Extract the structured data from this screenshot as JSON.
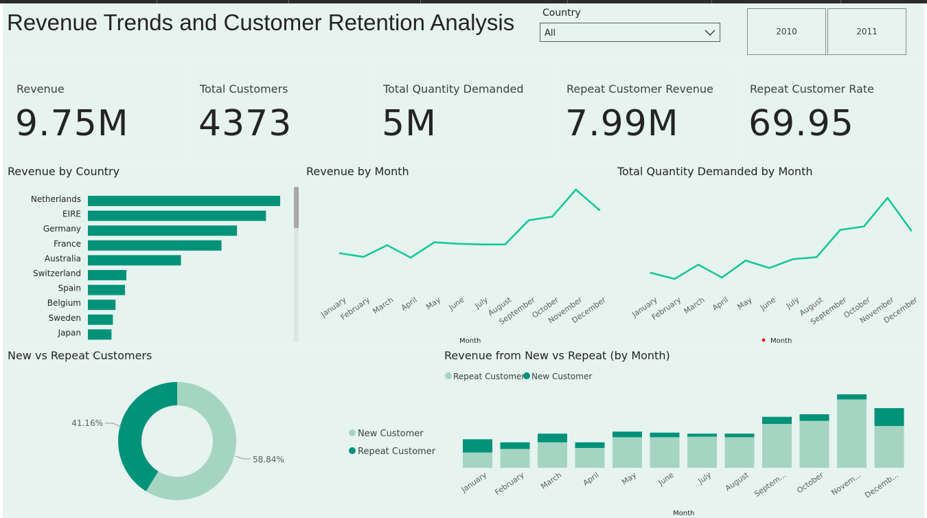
{
  "header": {
    "title": "Revenue Trends and Customer Retention Analysis",
    "country_filter": {
      "label": "Country",
      "value": "All"
    },
    "year_buttons": [
      "2010",
      "2011"
    ]
  },
  "cards": [
    {
      "label": "Revenue",
      "value": "9.75M"
    },
    {
      "label": "Total Customers",
      "value": "4373"
    },
    {
      "label": "Total Quantity Demanded",
      "value": "5M"
    },
    {
      "label": "Repeat Customer Revenue",
      "value": "7.99M"
    },
    {
      "label": "Repeat Customer Rate",
      "value": "69.95"
    }
  ],
  "colors": {
    "primary": "#01937a",
    "light": "#a5d5c2",
    "line": "#16c79a",
    "panel": "#e6f3ef",
    "legend_dot": "#e0201b"
  },
  "charts": {
    "revenue_by_country": {
      "title": "Revenue by Country"
    },
    "revenue_by_month": {
      "title": "Revenue by Month",
      "xlabel": "Month"
    },
    "quantity_by_month": {
      "title": "Total Quantity Demanded by Month",
      "xlabel": "Month"
    },
    "new_vs_repeat": {
      "title": "New vs Repeat Customers",
      "legend": [
        "New Customer",
        "Repeat Customer"
      ],
      "label_small": "41.16%",
      "label_large": "58.84%"
    },
    "revenue_new_vs_repeat": {
      "title": "Revenue from New vs Repeat (by Month)",
      "legend": [
        "Repeat Customer",
        "New Customer"
      ],
      "xlabel": "Month",
      "tick_labels": [
        "January",
        "February",
        "March",
        "April",
        "May",
        "June",
        "July",
        "August",
        "Septem...",
        "October",
        "Novem...",
        "Decemb..."
      ]
    }
  },
  "chart_data": [
    {
      "type": "bar",
      "orientation": "horizontal",
      "title": "Revenue by Country",
      "categories": [
        "Netherlands",
        "EIRE",
        "Germany",
        "France",
        "Australia",
        "Switzerland",
        "Spain",
        "Belgium",
        "Sweden",
        "Japan"
      ],
      "values": [
        285000,
        264000,
        221000,
        198000,
        138000,
        57000,
        55000,
        41000,
        37000,
        35000
      ]
    },
    {
      "type": "line",
      "title": "Revenue by Month",
      "xlabel": "Month",
      "categories": [
        "January",
        "February",
        "March",
        "April",
        "May",
        "June",
        "July",
        "August",
        "September",
        "October",
        "November",
        "December"
      ],
      "values": [
        570000,
        520000,
        680000,
        510000,
        720000,
        700000,
        690000,
        690000,
        1020000,
        1070000,
        1440000,
        1160000
      ]
    },
    {
      "type": "line",
      "title": "Total Quantity Demanded by Month",
      "xlabel": "Month",
      "categories": [
        "January",
        "February",
        "March",
        "April",
        "May",
        "June",
        "July",
        "August",
        "September",
        "October",
        "November",
        "December"
      ],
      "values": [
        310000,
        265000,
        370000,
        275000,
        400000,
        345000,
        410000,
        425000,
        625000,
        650000,
        860000,
        620000
      ]
    },
    {
      "type": "pie",
      "title": "New vs Repeat Customers",
      "categories": [
        "Repeat Customer",
        "New Customer"
      ],
      "values": [
        58.84,
        41.16
      ]
    },
    {
      "type": "bar",
      "stacked": true,
      "title": "Revenue from New vs Repeat (by Month)",
      "xlabel": "Month",
      "categories": [
        "January",
        "February",
        "March",
        "April",
        "May",
        "June",
        "July",
        "August",
        "September",
        "October",
        "November",
        "December"
      ],
      "series": [
        {
          "name": "Repeat Customer",
          "values": [
            300000,
            370000,
            500000,
            390000,
            600000,
            600000,
            610000,
            600000,
            860000,
            920000,
            1340000,
            820000
          ]
        },
        {
          "name": "New Customer",
          "values": [
            260000,
            130000,
            170000,
            110000,
            110000,
            90000,
            60000,
            70000,
            140000,
            130000,
            100000,
            350000
          ]
        }
      ]
    }
  ]
}
